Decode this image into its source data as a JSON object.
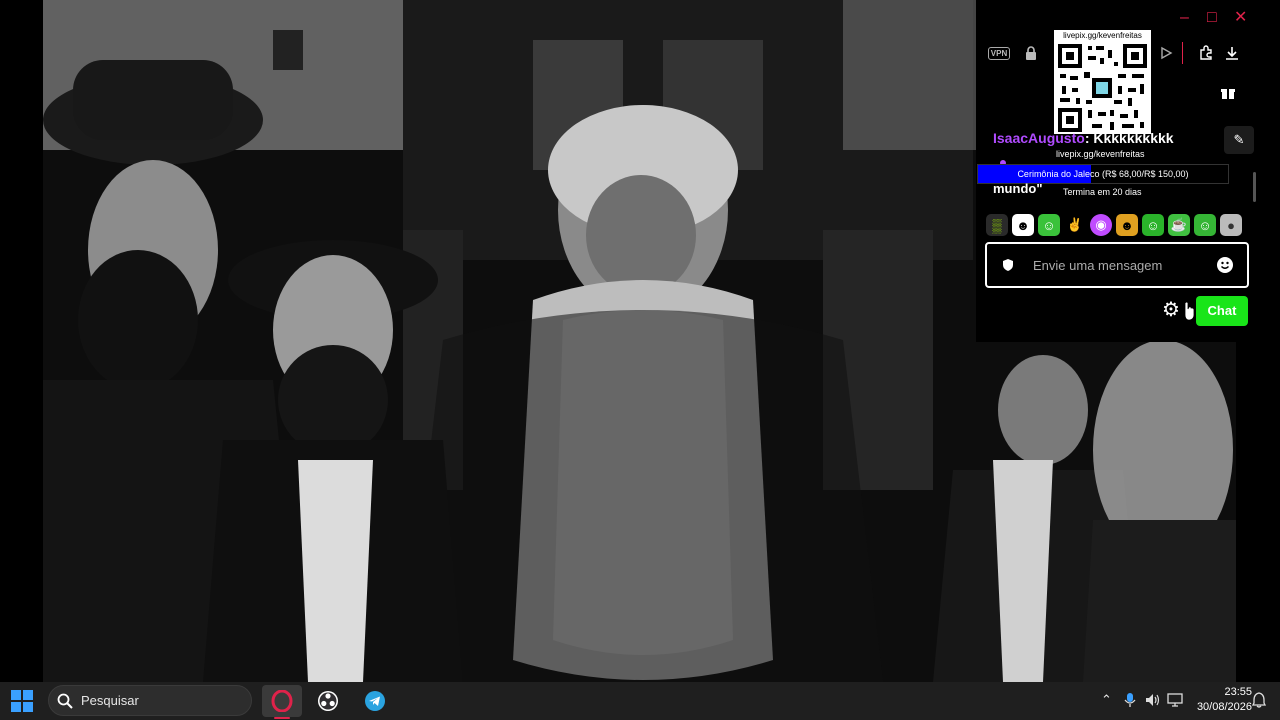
{
  "chat": {
    "vpn_label": "VPN",
    "qr_url": "livepix.gg/kevenfreitas",
    "url_under_qr": "livepix.gg/kevenfreitas",
    "message_user": "IsaacAugusto",
    "message_text": ": Kkkkkkkkkk",
    "partial_line": "mundo\"",
    "goal_text": "Cerimônia do Jaleco (R$ 68,00/R$ 150,00)",
    "goal_progress": 0.45,
    "goal_ends": "Termina em 20 dias",
    "input_placeholder": "Envie uma mensagem",
    "send_button": "Chat",
    "accent_color": "#19e519",
    "username_color": "#b04bff",
    "goal_color": "#0000ff"
  },
  "taskbar": {
    "search_placeholder": "Pesquisar",
    "time": "23:55",
    "date": "30/08/2026"
  },
  "icons": [
    "windows-start-icon",
    "search-icon",
    "opera-icon",
    "obs-icon",
    "telegram-icon",
    "chevron-up-icon",
    "microphone-icon",
    "speaker-icon",
    "network-icon",
    "bell-icon",
    "gear-icon",
    "smile-icon",
    "shield-icon",
    "pin-icon",
    "gift-icon",
    "lock-icon",
    "play-icon",
    "extension-icon",
    "download-icon",
    "minimize-icon",
    "maximize-icon",
    "close-icon"
  ]
}
